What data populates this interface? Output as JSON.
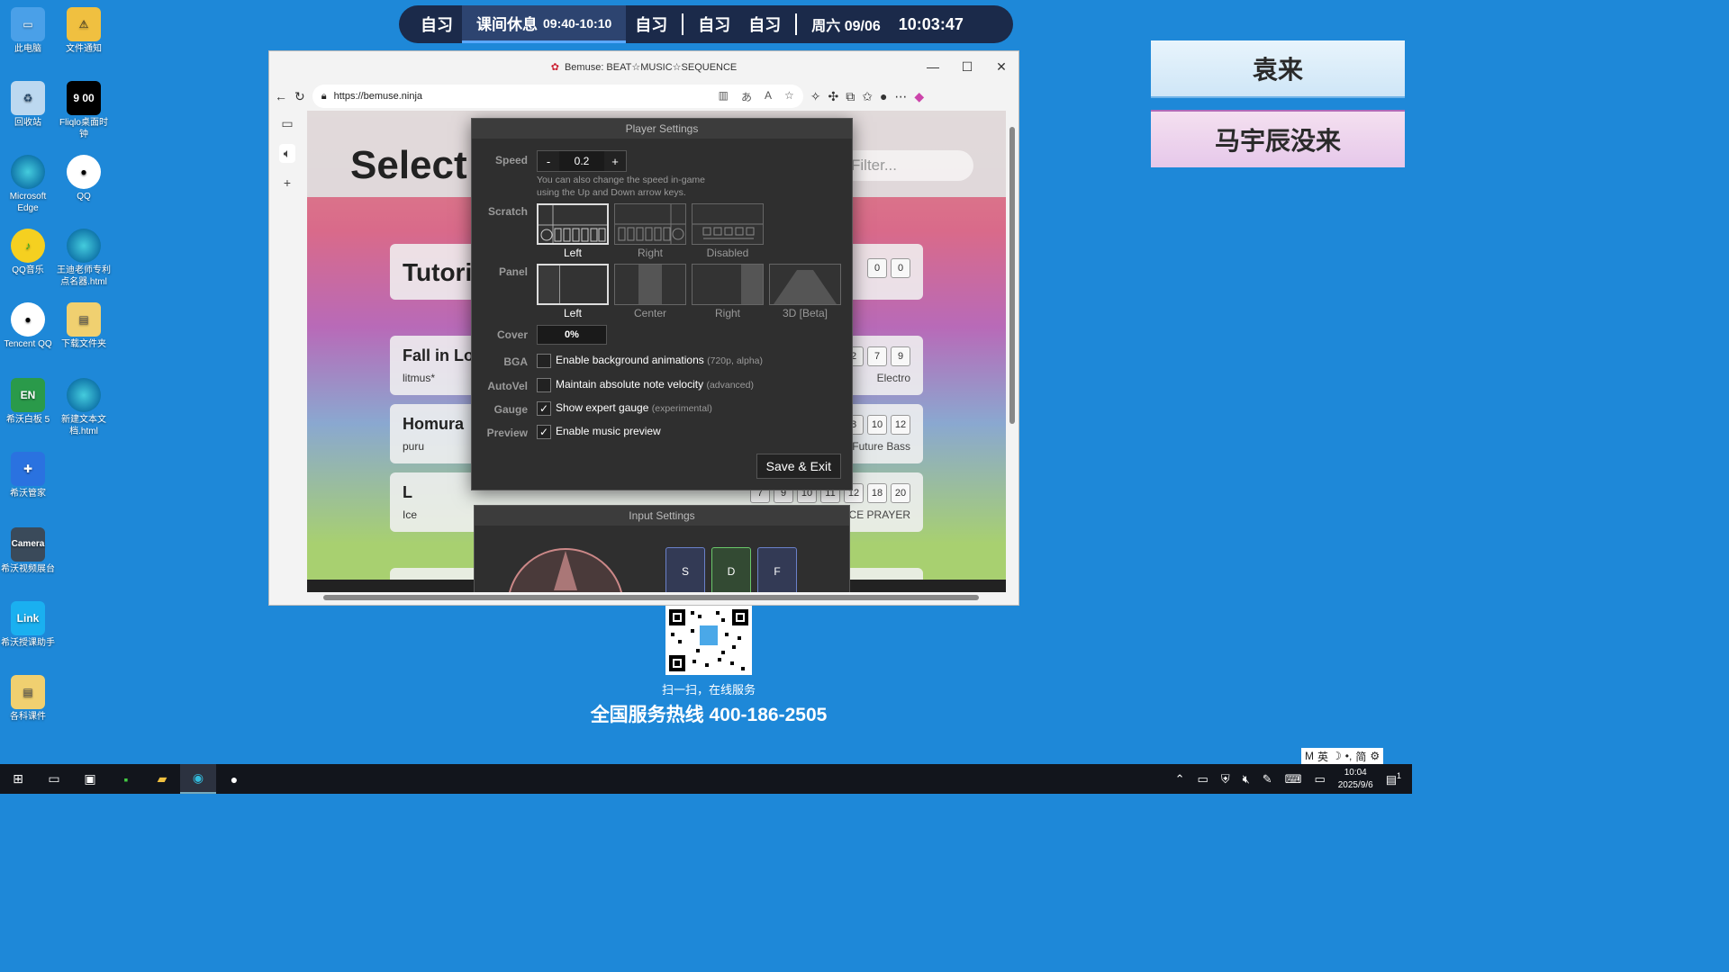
{
  "desktop": {
    "icons": [
      {
        "label": "此电脑",
        "icon": "computer-icon"
      },
      {
        "label": "文件通知",
        "icon": "folder-warning-icon"
      },
      {
        "label": "回收站",
        "icon": "recycle-bin-icon"
      },
      {
        "label": "Fliqlo桌面时钟",
        "icon": "clock-icon",
        "glyph": "9 00"
      },
      {
        "label": "Microsoft Edge",
        "icon": "edge-icon"
      },
      {
        "label": "QQ",
        "icon": "qq-icon"
      },
      {
        "label": "QQ音乐",
        "icon": "qq-music-icon"
      },
      {
        "label": "王迪老师专利点名器.html",
        "icon": "edge-icon"
      },
      {
        "label": "Tencent QQ",
        "icon": "qq-icon"
      },
      {
        "label": "下载文件夹",
        "icon": "folder-icon"
      },
      {
        "label": "希沃白板 5",
        "icon": "seewo-whiteboard-icon",
        "glyph": "EN"
      },
      {
        "label": "新建文本文档.html",
        "icon": "edge-icon"
      },
      {
        "label": "希沃管家",
        "icon": "shield-icon"
      },
      {
        "label": "希沃视频展台",
        "icon": "camera-icon",
        "glyph": "Camera"
      },
      {
        "label": "希沃授课助手",
        "icon": "link-icon",
        "glyph": "Link"
      },
      {
        "label": "各科课件",
        "icon": "folder-icon"
      }
    ]
  },
  "schedule": {
    "items": [
      "自习",
      "自习",
      "自习",
      "自习"
    ],
    "current_label": "课间休息",
    "current_time": "09:40-10:10",
    "date": "周六 09/06",
    "clock": "10:03:47"
  },
  "name_cards": [
    "袁来",
    "马宇辰没来"
  ],
  "browser": {
    "title": "Bemuse: BEAT☆MUSIC☆SEQUENCE",
    "url": "https://bemuse.ninja"
  },
  "page": {
    "heading": "Select M",
    "filter_placeholder": "Filter...",
    "songs": [
      {
        "name": "Tutorial",
        "artist": "",
        "levels": [
          "0",
          "0"
        ],
        "genre": ""
      },
      {
        "name": "Fall in Lov",
        "artist": "litmus*",
        "levels": [
          "2",
          "7",
          "9"
        ],
        "genre": "Electro"
      },
      {
        "name": "Homura",
        "artist": "puru",
        "levels": [
          "8",
          "10",
          "12"
        ],
        "genre": "Future Bass"
      },
      {
        "name": "L",
        "artist": "Ice",
        "levels": [
          "7",
          "9",
          "10",
          "11",
          "12",
          "18",
          "20"
        ],
        "genre": "ANCE PRAYER"
      }
    ]
  },
  "player_settings": {
    "title": "Player Settings",
    "speed_label": "Speed",
    "speed_value": "0.2",
    "minus": "-",
    "plus": "+",
    "speed_hint_1": "You can also change the speed in-game",
    "speed_hint_2": "using the Up and Down arrow keys.",
    "scratch_label": "Scratch",
    "scratch_options": [
      "Left",
      "Right",
      "Disabled"
    ],
    "scratch_selected": "Left",
    "panel_label": "Panel",
    "panel_options": [
      "Left",
      "Center",
      "Right",
      "3D [Beta]"
    ],
    "panel_selected": "Left",
    "cover_label": "Cover",
    "cover_value": "0%",
    "bga_label": "BGA",
    "bga_text": "Enable background animations",
    "bga_note": "(720p, alpha)",
    "bga_checked": false,
    "autovel_label": "AutoVel",
    "autovel_text": "Maintain absolute note velocity",
    "autovel_note": "(advanced)",
    "autovel_checked": false,
    "gauge_label": "Gauge",
    "gauge_text": "Show expert gauge",
    "gauge_note": "(experimental)",
    "gauge_checked": true,
    "preview_label": "Preview",
    "preview_text": "Enable music preview",
    "preview_checked": true,
    "save_label": "Save & Exit"
  },
  "input_settings": {
    "title": "Input Settings",
    "keys": [
      "S",
      "D",
      "F"
    ]
  },
  "promo": {
    "qr_caption": "扫一扫，在线服务",
    "hotline": "全国服务热线 400-186-2505"
  },
  "taskbar": {
    "time": "10:04",
    "date": "2025/9/6",
    "notification_count": "1"
  },
  "ime": {
    "lang": "英",
    "mode": "简"
  },
  "colors": {
    "desktop": "#1e88d8",
    "dialog": "#2f2f2f",
    "accent": "#5aa8ff"
  }
}
